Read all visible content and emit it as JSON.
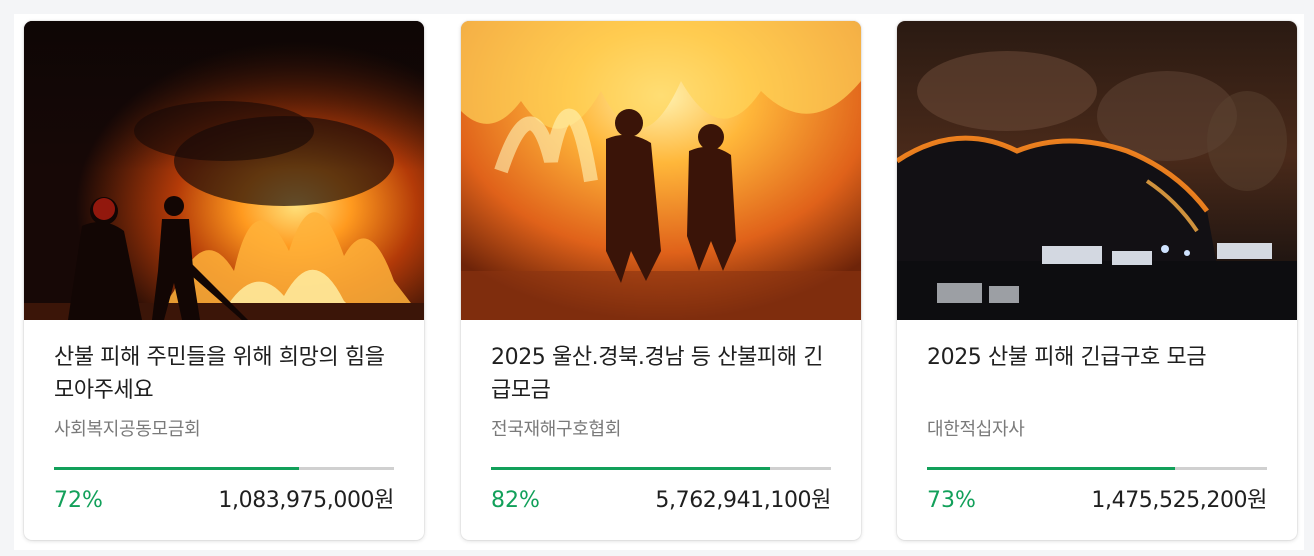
{
  "accent_color": "#12a05a",
  "campaigns": [
    {
      "image": "firefighters-at-night-fire",
      "title": "산불 피해 주민들을 위해 희망의 힘을 모아주세요",
      "organization": "사회복지공동모금회",
      "progress_percent": 72,
      "progress_label": "72%",
      "amount": "1,083,975,000원"
    },
    {
      "image": "firefighters-in-flames",
      "title": "2025 울산.경북.경남 등 산불피해 긴급모금",
      "organization": "전국재해구호협회",
      "progress_percent": 82,
      "progress_label": "82%",
      "amount": "5,762,941,100원"
    },
    {
      "image": "wildfire-on-mountain-at-night",
      "title": "2025 산불 피해 긴급구호 모금",
      "organization": "대한적십자사",
      "progress_percent": 73,
      "progress_label": "73%",
      "amount": "1,475,525,200원"
    }
  ]
}
